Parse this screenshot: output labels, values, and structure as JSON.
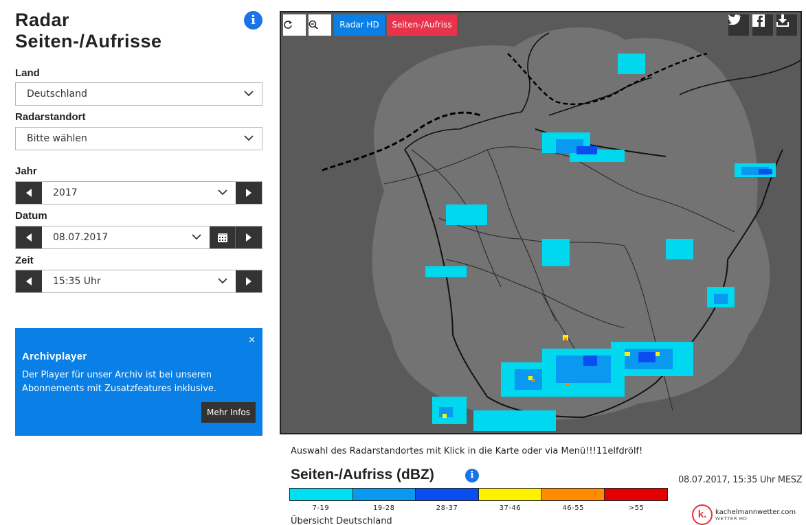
{
  "sidebar": {
    "title_line1": "Radar",
    "title_line2": "Seiten-/Aufrisse",
    "info_icon": "i",
    "country_label": "Land",
    "country_value": "Deutschland",
    "station_label": "Radarstandort",
    "station_value": "Bitte wählen",
    "year_label": "Jahr",
    "year_value": "2017",
    "date_label": "Datum",
    "date_value": "08.07.2017",
    "time_label": "Zeit",
    "time_value": "15:35 Uhr"
  },
  "promo": {
    "close": "×",
    "title": "Archivplayer",
    "text": "Der Player für unser Archiv ist bei unseren Abonnements mit Zusatzfeatures inklusive.",
    "button": "Mehr Infos"
  },
  "map": {
    "buttons": {
      "radar_hd": "Radar HD",
      "sections": "Seiten-/Aufriss"
    },
    "colors": {
      "radar_hd": "#0a7fe6",
      "sections": "#e8334a",
      "background": "#5a5a5a",
      "coverage": "#737373"
    },
    "icons": [
      "refresh-icon",
      "zoom-out-icon",
      "twitter-icon",
      "facebook-icon",
      "download-icon"
    ]
  },
  "footer": {
    "hint": "Auswahl des Radarstandortes mit Klick in die Karte oder via Menü!!!11elfdrölf!",
    "legend_title": "Seiten-/Aufriss (dBZ)",
    "legend_info": "i",
    "timestamp": "08.07.2017, 15:35 Uhr MESZ",
    "overview": "Übersicht Deutschland",
    "brand_logo": "k.",
    "brand_name": "kachelmannwetter.com",
    "brand_sub": "WETTER HD"
  },
  "legend": [
    {
      "label": "7-19",
      "color": "#00e0f5"
    },
    {
      "label": "19-28",
      "color": "#0a98f0"
    },
    {
      "label": "28-37",
      "color": "#0a4ef0"
    },
    {
      "label": "37-46",
      "color": "#fff200"
    },
    {
      "label": "46-55",
      "color": "#ff8c00"
    },
    {
      "label": ">55",
      "color": "#e30000"
    }
  ]
}
